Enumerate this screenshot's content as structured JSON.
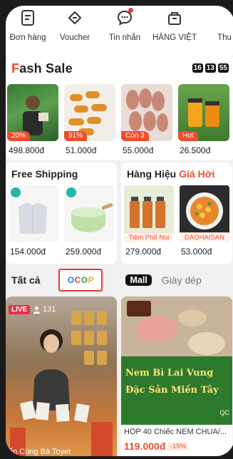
{
  "topnav": {
    "items": [
      {
        "label": "Đơn hàng",
        "icon": "orders-icon"
      },
      {
        "label": "Voucher",
        "icon": "voucher-icon"
      },
      {
        "label": "Tin nhắn",
        "icon": "chat-icon"
      },
      {
        "label": "HÀNG VIỆT",
        "icon": "basket-icon"
      },
      {
        "label": "Thu",
        "icon": "more-icon"
      }
    ]
  },
  "flash_sale": {
    "title_a": "F",
    "title_b": "ash Sale",
    "timer": [
      "16",
      "13",
      "55"
    ],
    "items": [
      {
        "badge": "20%",
        "price": "498.800đ"
      },
      {
        "badge": "91%",
        "price": "51.000đ"
      },
      {
        "badge": "Còn 3",
        "price": "55.000đ"
      },
      {
        "badge": "Hot",
        "price": "26.500đ"
      }
    ]
  },
  "free_shipping": {
    "title": "Free Shipping",
    "items": [
      {
        "price": "154.000đ"
      },
      {
        "price": "259.000đ"
      }
    ]
  },
  "brand": {
    "title_a": "Hàng Hiệu ",
    "title_b": "Giá Hời",
    "items": [
      {
        "shop": "Tiệm Phố Núi",
        "price": "279.000đ"
      },
      {
        "shop": "DAOHAISAN",
        "price": "53.000đ"
      }
    ]
  },
  "tabs": {
    "all": "Tất cả",
    "ocop": [
      "O",
      "C",
      "O",
      "P"
    ],
    "mall": "Mall",
    "shoes": "Giày dép"
  },
  "live_card": {
    "badge": "LIVE",
    "viewers": "131",
    "caption": "ẩn Cùng Bà Toyet"
  },
  "product_card": {
    "banner_line1": "Nem Bì Lai Vung",
    "banner_line2": "Đặc Sản Miền Tây",
    "qc": "QC",
    "name": "HỘP 40 Chiếc NEM CHUA/...",
    "price": "119.000đ",
    "discount": "-15%"
  }
}
